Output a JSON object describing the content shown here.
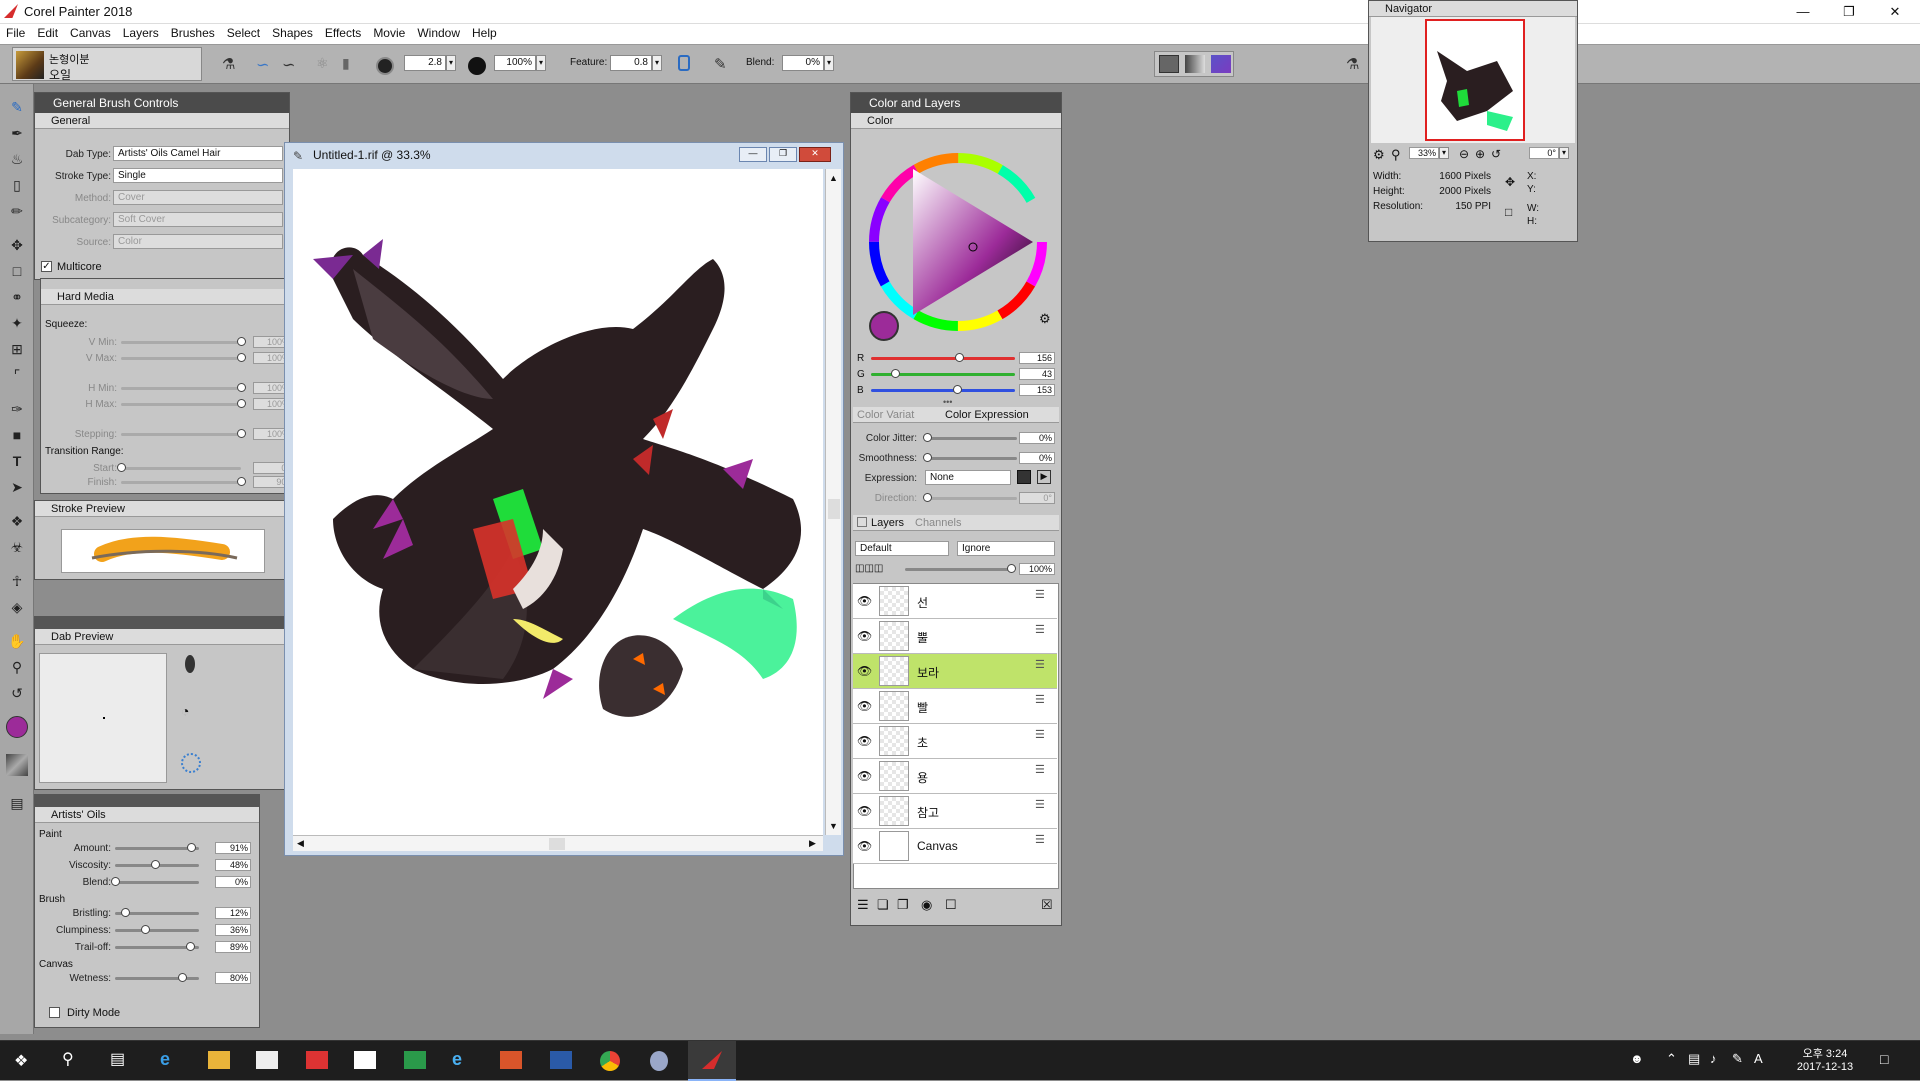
{
  "app": {
    "title": "Corel Painter 2018"
  },
  "menu": [
    "File",
    "Edit",
    "Canvas",
    "Layers",
    "Brushes",
    "Select",
    "Shapes",
    "Effects",
    "Movie",
    "Window",
    "Help"
  ],
  "brush_selector": {
    "category": "논형이분",
    "variant": "오일"
  },
  "property_bar": {
    "size": "2.8",
    "opacity": "100%",
    "feature_label": "Feature:",
    "feature": "0.8",
    "blend_label": "Blend:",
    "blend": "0%"
  },
  "general_panel": {
    "title": "General Brush Controls",
    "tab": "General",
    "fields": [
      {
        "label": "Dab Type:",
        "value": "Artists' Oils Camel Hair",
        "enabled": true
      },
      {
        "label": "Stroke Type:",
        "value": "Single",
        "enabled": true
      },
      {
        "label": "Method:",
        "value": "Cover",
        "enabled": false
      },
      {
        "label": "Subcategory:",
        "value": "Soft Cover",
        "enabled": false
      },
      {
        "label": "Source:",
        "value": "Color",
        "enabled": false
      }
    ],
    "multicore": "Multicore"
  },
  "hard_media": {
    "title": "Hard Media",
    "squeeze": "Squeeze:",
    "sliders": [
      {
        "label": "V Min:",
        "value": "100%",
        "pos": 1.0
      },
      {
        "label": "V Max:",
        "value": "100%",
        "pos": 1.0
      },
      {
        "label": "H Min:",
        "value": "100%",
        "pos": 1.0
      },
      {
        "label": "H Max:",
        "value": "100%",
        "pos": 1.0
      },
      {
        "label": "Stepping:",
        "value": "100%",
        "pos": 1.0
      }
    ],
    "transition": "Transition Range:",
    "trans_sliders": [
      {
        "label": "Start:",
        "value": "0°",
        "pos": 0.0
      },
      {
        "label": "Finish:",
        "value": "90°",
        "pos": 1.0
      }
    ]
  },
  "stroke_preview": {
    "title": "Stroke Preview"
  },
  "dab_preview": {
    "title": "Dab Preview"
  },
  "artists_oils": {
    "title": "Artists' Oils",
    "groups": [
      {
        "name": "Paint",
        "items": [
          {
            "label": "Amount:",
            "value": "91%",
            "pos": 0.91
          },
          {
            "label": "Viscosity:",
            "value": "48%",
            "pos": 0.48
          },
          {
            "label": "Blend:",
            "value": "0%",
            "pos": 0.0
          }
        ]
      },
      {
        "name": "Brush",
        "items": [
          {
            "label": "Bristling:",
            "value": "12%",
            "pos": 0.12
          },
          {
            "label": "Clumpiness:",
            "value": "36%",
            "pos": 0.36
          },
          {
            "label": "Trail-off:",
            "value": "89%",
            "pos": 0.89
          }
        ]
      },
      {
        "name": "Canvas",
        "items": [
          {
            "label": "Wetness:",
            "value": "80%",
            "pos": 0.8
          }
        ]
      }
    ],
    "dirty_mode": "Dirty Mode"
  },
  "document": {
    "title": "Untitled-1.rif @ 33.3%"
  },
  "color_layers": {
    "title": "Color and Layers",
    "color_tab": "Color",
    "current_color": "#9c2b99",
    "rgb": [
      {
        "label": "R",
        "value": "156",
        "pos": 0.61
      },
      {
        "label": "G",
        "value": "43",
        "pos": 0.17
      },
      {
        "label": "B",
        "value": "153",
        "pos": 0.6
      }
    ],
    "tabs": [
      "Color Variat",
      "Color Expression"
    ],
    "expression": [
      {
        "label": "Color Jitter:",
        "value": "0%"
      },
      {
        "label": "Smoothness:",
        "value": "0%"
      },
      {
        "label": "Expression:",
        "value": "None"
      },
      {
        "label": "Direction:",
        "value": "0°"
      }
    ]
  },
  "layers": {
    "tabs": [
      "Layers",
      "Channels"
    ],
    "composite_method": "Default",
    "composite_depth": "Ignore",
    "opacity": "100%",
    "items": [
      {
        "name": "선",
        "selected": false
      },
      {
        "name": "뿔",
        "selected": false
      },
      {
        "name": "보라",
        "selected": true
      },
      {
        "name": "빨",
        "selected": false
      },
      {
        "name": "초",
        "selected": false
      },
      {
        "name": "용",
        "selected": false
      },
      {
        "name": "참고",
        "selected": false
      },
      {
        "name": "Canvas",
        "selected": false
      }
    ]
  },
  "navigator": {
    "title": "Navigator",
    "zoom": "33%",
    "rotation": "0°",
    "info": [
      {
        "label": "Width:",
        "value": "1600 Pixels"
      },
      {
        "label": "Height:",
        "value": "2000 Pixels"
      },
      {
        "label": "Resolution:",
        "value": "150 PPI"
      }
    ],
    "coords": [
      "X:",
      "Y:",
      "W:",
      "H:"
    ]
  },
  "taskbar": {
    "time": "오후 3:24",
    "date": "2017-12-13",
    "ime": "A"
  }
}
